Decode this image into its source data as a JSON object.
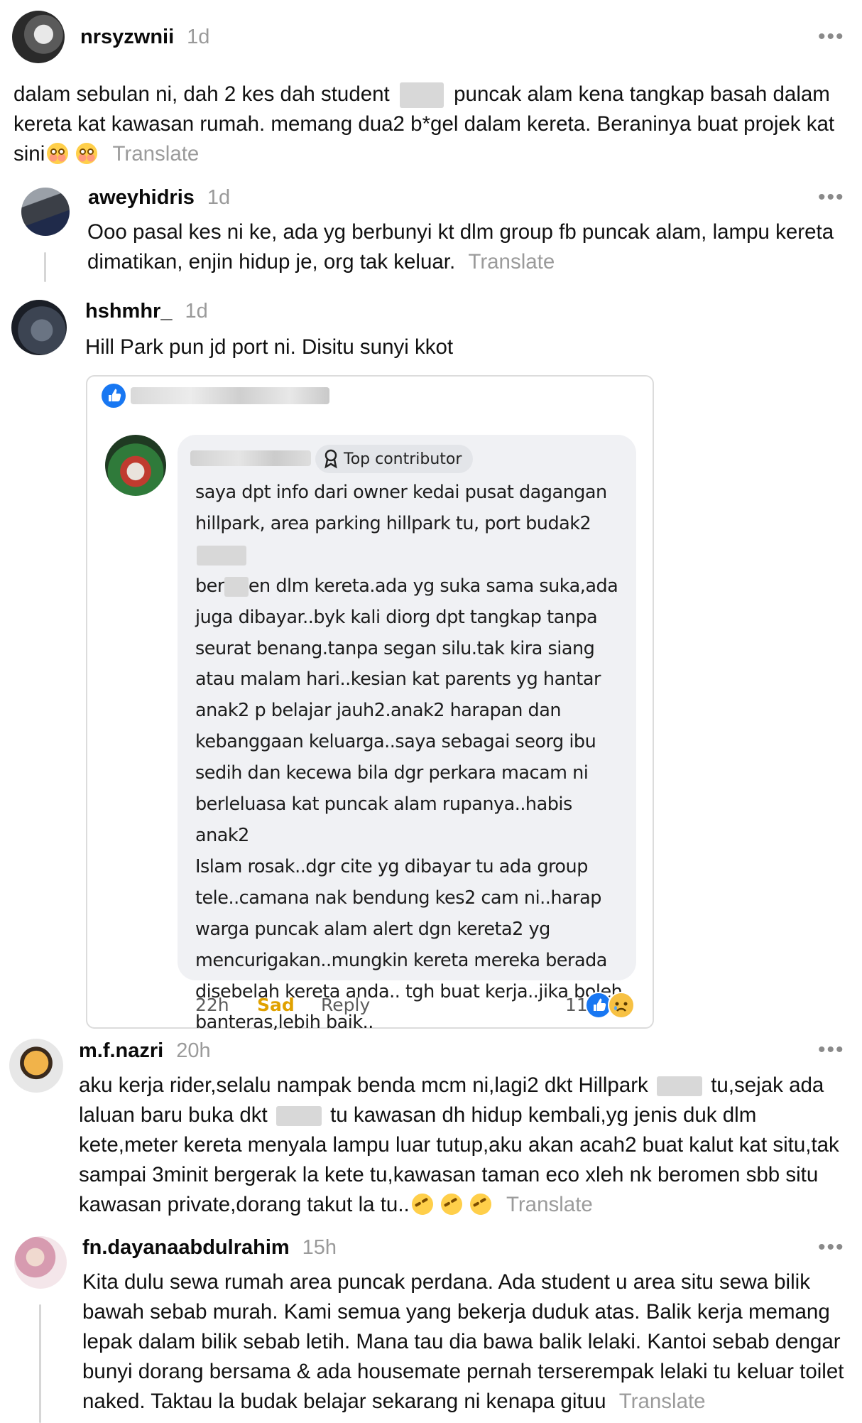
{
  "comments": [
    {
      "username": "nrsyzwnii",
      "time": "1d",
      "text_1": "dalam sebulan ni, dah 2 kes dah student",
      "text_2": "puncak alam kena tangkap basah dalam kereta kat kawasan rumah. memang dua2 b*gel dalam kereta. Beraninya buat projek kat sini",
      "translate": "Translate",
      "emoji": "flushed-face"
    },
    {
      "username": "aweyhidris",
      "time": "1d",
      "text": "Ooo pasal kes ni ke, ada yg berbunyi kt dlm group fb puncak alam, lampu kereta dimatikan, enjin hidup je, org tak keluar.",
      "translate": "Translate"
    },
    {
      "username": "hshmhr_",
      "time": "1d",
      "text": "Hill Park pun jd port ni. Disitu sunyi kkot"
    },
    {
      "username": "m.f.nazri",
      "time": "20h",
      "text_1": "aku kerja rider,selalu nampak benda mcm ni,lagi2 dkt Hillpark",
      "text_2": "tu,sejak ada laluan baru buka dkt",
      "text_3": "tu kawasan dh hidup kembali,yg jenis duk dlm kete,meter kereta menyala lampu luar tutup,aku akan acah2 buat kalut kat situ,tak sampai 3minit bergerak la kete tu,kawasan taman eco xleh nk beromen sbb situ kawasan private,dorang takut la tu..",
      "translate": "Translate",
      "emoji": "rofl-face"
    },
    {
      "username": "fn.dayanaabdulrahim",
      "time": "15h",
      "text": "Kita dulu sewa rumah area puncak perdana. Ada student u area situ sewa bilik bawah sebab murah. Kami semua yang bekerja duduk atas. Balik kerja memang lepak dalam bilik sebab letih. Mana tau dia bawa balik lelaki. Kantoi sebab dengar bunyi dorang bersama & ada housemate pernah terserempak lelaki tu keluar toilet naked. Taktau la budak belajar sekarang ni kenapa gituu",
      "translate": "Translate"
    }
  ],
  "embedded_post": {
    "badge": "Top contributor",
    "lines": [
      "saya dpt info dari owner kedai pusat dagangan",
      "hillpark, area parking hillpark tu, port budak2",
      "ber",
      "en dlm kereta.ada yg suka sama suka,ada",
      "juga dibayar..byk kali diorg dpt tangkap tanpa",
      "seurat benang.tanpa segan silu.tak kira siang",
      "atau malam hari..kesian kat parents yg hantar",
      "anak2 p belajar jauh2.anak2 harapan dan",
      "kebanggaan keluarga..saya sebagai seorg ibu",
      "sedih dan kecewa bila dgr perkara macam ni",
      "berleluasa kat puncak alam rupanya..habis anak2",
      "Islam rosak..dgr cite yg dibayar tu ada group",
      "tele..camana nak bendung kes2 cam ni..harap",
      "warga puncak alam alert dgn kereta2 yg",
      "mencurigakan..mungkin kereta mereka berada",
      "disebelah kereta anda.. tgh buat kerja..jika boleh",
      "banteras,lebih baik.."
    ],
    "time": "22h",
    "reaction_label": "Sad",
    "reply_label": "Reply",
    "reaction_count": "11"
  },
  "icons": {
    "more": "more-options-icon",
    "like": "like-reaction-icon",
    "sad": "sad-reaction-icon",
    "contributor": "top-contributor-icon"
  },
  "colors": {
    "link_grey": "#9b9b9b",
    "sad_orange": "#e0a100",
    "fb_blue": "#1877f2"
  }
}
